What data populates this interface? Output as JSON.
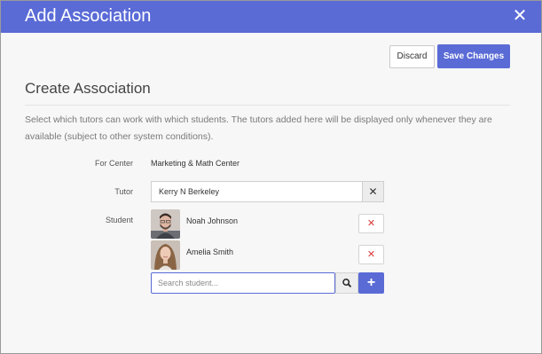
{
  "dialog": {
    "title": "Add Association",
    "close_glyph": "✕"
  },
  "toolbar": {
    "discard_label": "Discard",
    "save_label": "Save Changes"
  },
  "section": {
    "title": "Create Association",
    "description": "Select which tutors can work with which students. The tutors added here will be displayed only whenever they are available (subject to other system conditions)."
  },
  "form": {
    "center_label": "For Center",
    "center_value": "Marketing & Math Center",
    "tutor_label": "Tutor",
    "tutor_value": "Kerry  N Berkeley",
    "tutor_clear_glyph": "✕",
    "student_label": "Student",
    "students": [
      {
        "name": "Noah Johnson",
        "avatar": "male-avatar"
      },
      {
        "name": "Amelia Smith",
        "avatar": "female-avatar"
      }
    ],
    "remove_glyph": "✕",
    "search_placeholder": "Search student...",
    "add_glyph": "+"
  },
  "colors": {
    "accent": "#5a6bd6",
    "remove": "#d83a3a",
    "background": "#f7f7f7"
  },
  "icons": {
    "close": "close-icon",
    "search": "search-icon",
    "add": "plus-icon",
    "remove": "remove-icon"
  }
}
